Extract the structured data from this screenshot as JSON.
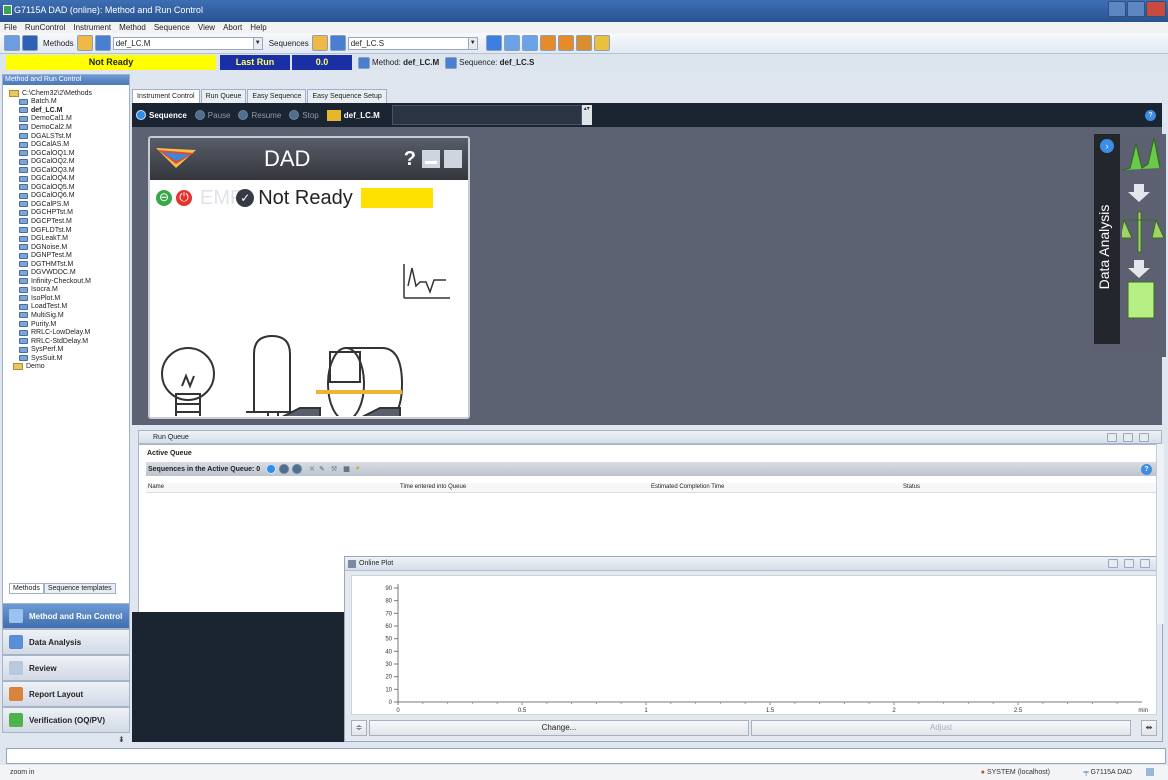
{
  "titlebar": {
    "title": "G7115A DAD (online): Method and Run Control"
  },
  "menu": [
    "File",
    "RunControl",
    "Instrument",
    "Method",
    "Sequence",
    "View",
    "Abort",
    "Help"
  ],
  "toolbar": {
    "methods_label": "Methods",
    "method_value": "def_LC.M",
    "sequences_label": "Sequences",
    "sequence_value": "def_LC.S"
  },
  "status": {
    "not_ready": "Not Ready",
    "last_run": "Last Run",
    "last_run_value": "0.0",
    "method_label": "Method:",
    "method_value": "def_LC.M",
    "sequence_label": "Sequence:",
    "sequence_value": "def_LC.S",
    "colors": {
      "not_ready_bg": "#ffff00",
      "last_run_bg": "#1a2fa3"
    }
  },
  "leftpane": {
    "title": "Method and Run Control",
    "root": "C:\\Chem32\\2\\Methods",
    "items": [
      "Batch.M",
      "def_LC.M",
      "DemoCal1.M",
      "DemoCal2.M",
      "DGALSTst.M",
      "DGCalAS.M",
      "DGCalOQ1.M",
      "DGCalOQ2.M",
      "DGCalOQ3.M",
      "DGCalOQ4.M",
      "DGCalOQ5.M",
      "DGCalOQ6.M",
      "DGCalPS.M",
      "DGCHPTst.M",
      "DGCPTest.M",
      "DGFLDTst.M",
      "DGLeakT.M",
      "DGNoise.M",
      "DGNPTest.M",
      "DGTHMTst.M",
      "DGVWDDC.M",
      "Infinity-Checkout.M",
      "Isocra.M",
      "IsoPlot.M",
      "LoadTest.M",
      "MultiSig.M",
      "Purity.M",
      "RRLC-LowDelay.M",
      "RRLC-StdDelay.M",
      "SysPerf.M",
      "SysSuit.M"
    ],
    "folder": "Demo",
    "bottom_tabs": [
      "Methods",
      "Sequence templates"
    ]
  },
  "nav": [
    "Method and Run Control",
    "Data Analysis",
    "Review",
    "Report Layout",
    "Verification (OQ/PV)"
  ],
  "tabs": [
    "Instrument Control",
    "Run Queue",
    "Easy Sequence",
    "Easy Sequence Setup"
  ],
  "seqbar": {
    "sequence": "Sequence",
    "pause": "Pause",
    "resume": "Resume",
    "stop": "Stop",
    "method": "def_LC.M"
  },
  "module": {
    "title": "DAD",
    "help": "?",
    "emf": "EMF",
    "status": "Not Ready"
  },
  "data_analysis": {
    "label": "Data Analysis"
  },
  "run_queue": {
    "title": "Run Queue",
    "active_queue": "Active Queue",
    "sequences_label": "Sequences in the Active Queue: 0",
    "columns": [
      "Name",
      "Time entered into Queue",
      "Estimated Completion Time",
      "Status"
    ]
  },
  "online_plot": {
    "title": "Online Plot",
    "change": "Change...",
    "adjust": "Adjust"
  },
  "chart_data": {
    "type": "line",
    "title": "",
    "xlabel": "min",
    "ylabel": "",
    "xlim": [
      0,
      3.0
    ],
    "ylim": [
      0,
      90
    ],
    "x_ticks": [
      "0",
      "0.5",
      "1",
      "1.5",
      "2",
      "2.5"
    ],
    "y_ticks": [
      "90",
      "80",
      "70",
      "60",
      "50",
      "40",
      "30",
      "20",
      "10",
      "0"
    ],
    "series": []
  },
  "footer": {
    "status_left": "zoom in",
    "system": "SYSTEM (localhost)",
    "instrument": "G7115A DAD"
  }
}
